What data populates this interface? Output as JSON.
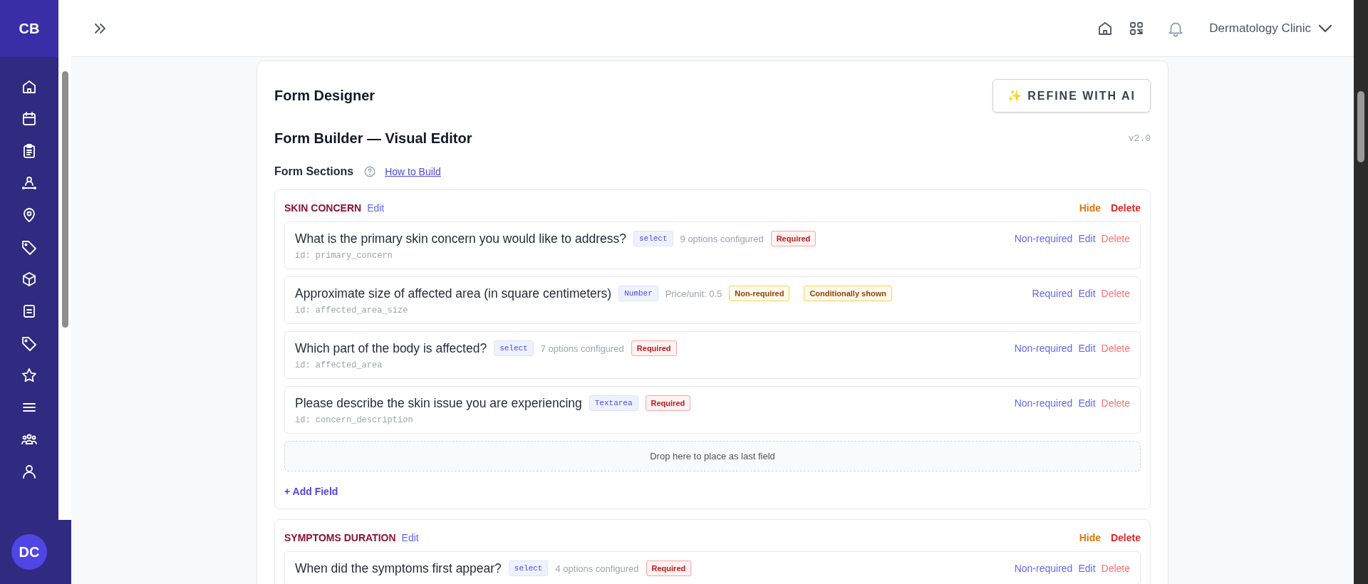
{
  "brand": {
    "initials": "CB"
  },
  "user": {
    "initials": "DC"
  },
  "topbar": {
    "clinic": "Dermatology Clinic"
  },
  "designer": {
    "title": "Form Designer",
    "refine_button": "✨ REFINE WITH AI",
    "subtitle": "Form Builder — Visual Editor",
    "version": "v2.0",
    "sections_label": "Form Sections",
    "help_link": "How to Build"
  },
  "sections": [
    {
      "title": "SKIN CONCERN",
      "edit": "Edit",
      "hide": "Hide",
      "delete": "Delete",
      "drop_zone": "Drop here to place as last field",
      "add_field": "+ Add Field",
      "fields": [
        {
          "label": "What is the primary skin concern you would like to address?",
          "type_tag": "select",
          "info": "9 options configured",
          "required": true,
          "badge": "Required",
          "id": "id: primary_concern",
          "toggle": "Non-required",
          "edit": "Edit",
          "delete": "Delete"
        },
        {
          "label": "Approximate size of affected area (in square centimeters)",
          "type_tag": "Number",
          "info": "Price/unit: 0.5",
          "required": false,
          "badge": "Non-required",
          "conditional": "Conditionally shown",
          "id": "id: affected_area_size",
          "toggle": "Required",
          "edit": "Edit",
          "delete": "Delete"
        },
        {
          "label": "Which part of the body is affected?",
          "type_tag": "select",
          "info": "7 options configured",
          "required": true,
          "badge": "Required",
          "id": "id: affected_area",
          "toggle": "Non-required",
          "edit": "Edit",
          "delete": "Delete"
        },
        {
          "label": "Please describe the skin issue you are experiencing",
          "type_tag": "Textarea",
          "required": true,
          "badge": "Required",
          "id": "id: concern_description",
          "toggle": "Non-required",
          "edit": "Edit",
          "delete": "Delete"
        }
      ]
    },
    {
      "title": "SYMPTOMS DURATION",
      "edit": "Edit",
      "hide": "Hide",
      "delete": "Delete",
      "fields": [
        {
          "label": "When did the symptoms first appear?",
          "type_tag": "select",
          "info": "4 options configured",
          "required": true,
          "badge": "Required",
          "toggle": "Non-required",
          "edit": "Edit",
          "delete": "Delete"
        }
      ]
    }
  ]
}
